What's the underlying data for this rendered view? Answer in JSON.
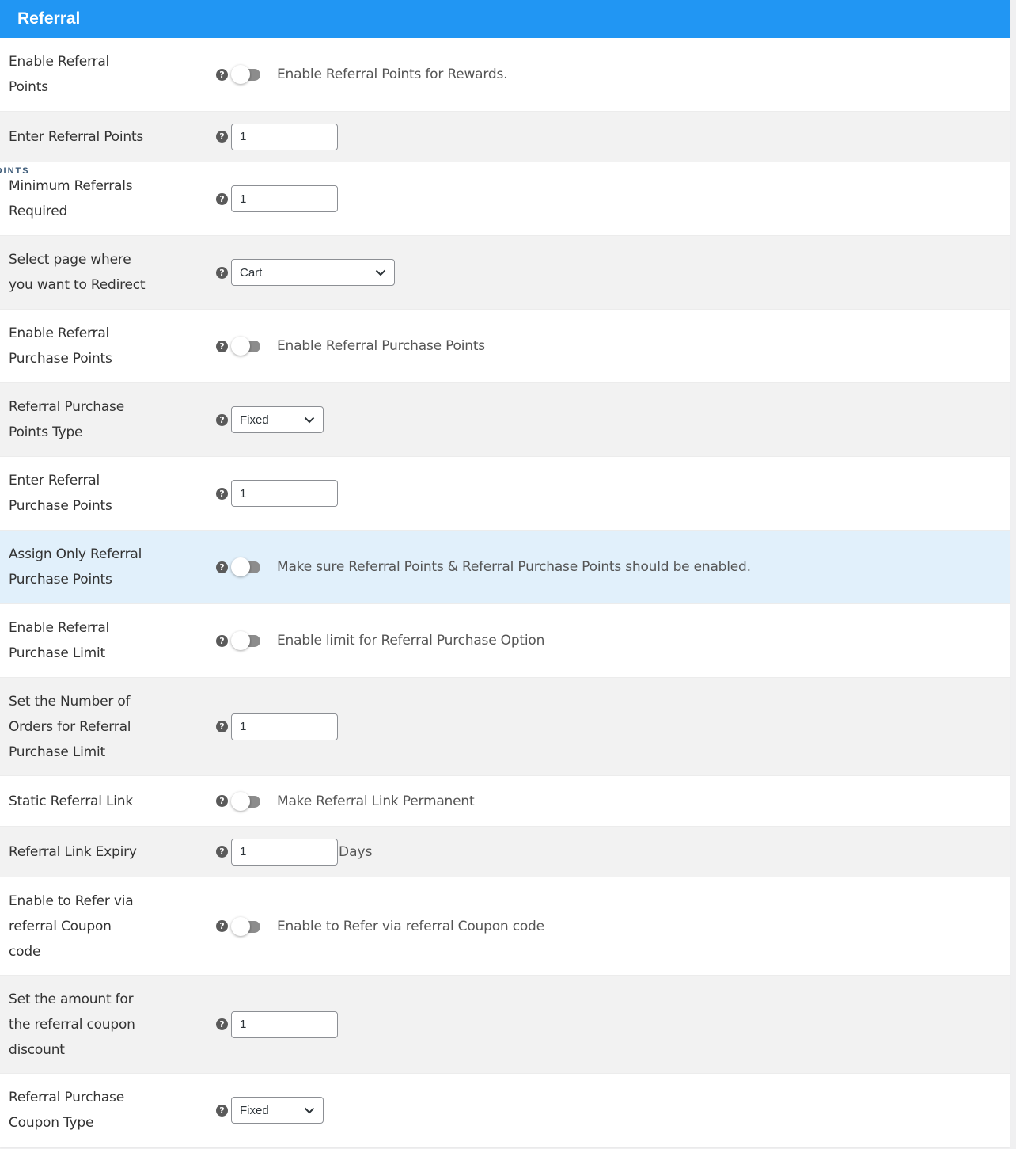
{
  "header": {
    "title": "Referral"
  },
  "overlay_text": "OINTS",
  "help_glyph": "?",
  "rows": [
    {
      "label": "Enable Referral Points",
      "control": "toggle",
      "description": "Enable Referral Points for Rewards."
    },
    {
      "label": "Enter Referral Points",
      "control": "input",
      "value": "1"
    },
    {
      "label": "Minimum Referrals Required",
      "control": "input",
      "value": "1"
    },
    {
      "label": "Select page where you want to Redirect",
      "control": "select",
      "value": "Cart"
    },
    {
      "label": "Enable Referral Purchase Points",
      "control": "toggle",
      "description": "Enable Referral Purchase Points"
    },
    {
      "label": "Referral Purchase Points Type",
      "control": "select",
      "value": "Fixed"
    },
    {
      "label": "Enter Referral Purchase Points",
      "control": "input",
      "value": "1"
    },
    {
      "label": "Assign Only Referral Purchase Points",
      "control": "toggle",
      "description": "Make sure Referral Points & Referral Purchase Points should be enabled."
    },
    {
      "label": "Enable Referral Purchase Limit",
      "control": "toggle",
      "description": "Enable limit for Referral Purchase Option"
    },
    {
      "label": "Set the Number of Orders for Referral Purchase Limit",
      "control": "input",
      "value": "1"
    },
    {
      "label": "Static Referral Link",
      "control": "toggle",
      "description": "Make Referral Link Permanent"
    },
    {
      "label": "Referral Link Expiry",
      "control": "input",
      "value": "1",
      "suffix": "Days"
    },
    {
      "label": "Enable to Refer via referral Coupon code",
      "control": "toggle",
      "description": "Enable to Refer via referral Coupon code"
    },
    {
      "label": "Set the amount for the referral coupon discount",
      "control": "input",
      "value": "1"
    },
    {
      "label": "Referral Purchase Coupon Type",
      "control": "select",
      "value": "Fixed"
    }
  ],
  "colors": {
    "header_bg": "#2196f3",
    "row_alt": "#f2f2f2",
    "row_highlight": "#e1f0fb",
    "toggle_off": "#8c8c8c"
  }
}
